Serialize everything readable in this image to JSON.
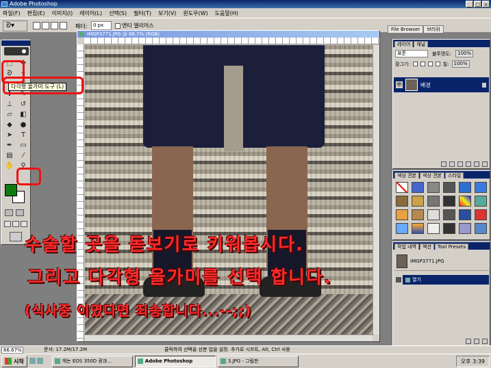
{
  "window": {
    "title": "Adobe Photoshop",
    "buttons": [
      "_",
      "□",
      "×"
    ]
  },
  "menubar": {
    "items": [
      "파일(F)",
      "편집(E)",
      "이미지(I)",
      "레이어(L)",
      "선택(S)",
      "필터(T)",
      "보기(V)",
      "윈도우(W)",
      "도움말(H)"
    ]
  },
  "options": {
    "preset_icon": "lasso-icon",
    "feather_label": "페더:",
    "feather_value": "0 px",
    "antialias_label": "앤티 앨리어스",
    "palette_tabs": [
      "File Browser",
      "브러쉬"
    ]
  },
  "toolbox": {
    "tooltip": "다각형 올가미 도구 (L)",
    "foreground_color": "#0e7a0e",
    "background_color": "#ffffff"
  },
  "document": {
    "title": "IMGP3771.JPG @ 66.7% (RGB)",
    "caption_lines": [
      "수술할 곳을 돋보기로 키워봅시다.",
      "그리고 다각형 올가미를 선택 합니다.",
      "(식사중 이였다면 죄송합니다...--;;)"
    ],
    "annotation_color": "#e11111"
  },
  "layers_panel": {
    "tabs": [
      "레이어",
      "채널"
    ],
    "blend_mode": "표준",
    "opacity_label": "불투명도:",
    "opacity_value": "100%",
    "lock_label": "잠그기:",
    "fill_label": "칠:",
    "fill_value": "100%",
    "layer_name": "배경"
  },
  "styles_panel": {
    "tabs": [
      "색상 견본",
      "색상 견본",
      "스타일"
    ]
  },
  "history_panel": {
    "tabs": [
      "작업 내역",
      "액션",
      "Tool Presets"
    ],
    "snapshot_name": "IMGP3771.JPG",
    "step_name": "열기"
  },
  "status": {
    "zoom": "66.67%",
    "doc_size": "문서: 17.2M/17.2M",
    "hint": "클릭하여 선택을 선분 업을 설정. 추가로 시프트, Alt, Ctrl 사용"
  },
  "taskbar": {
    "start_label": "시작",
    "tasks": [
      "캐논 EOS 350D 광과...",
      "Adobe Photoshop",
      "3.JPG - 그림판"
    ],
    "clock": "오후 3:39"
  }
}
